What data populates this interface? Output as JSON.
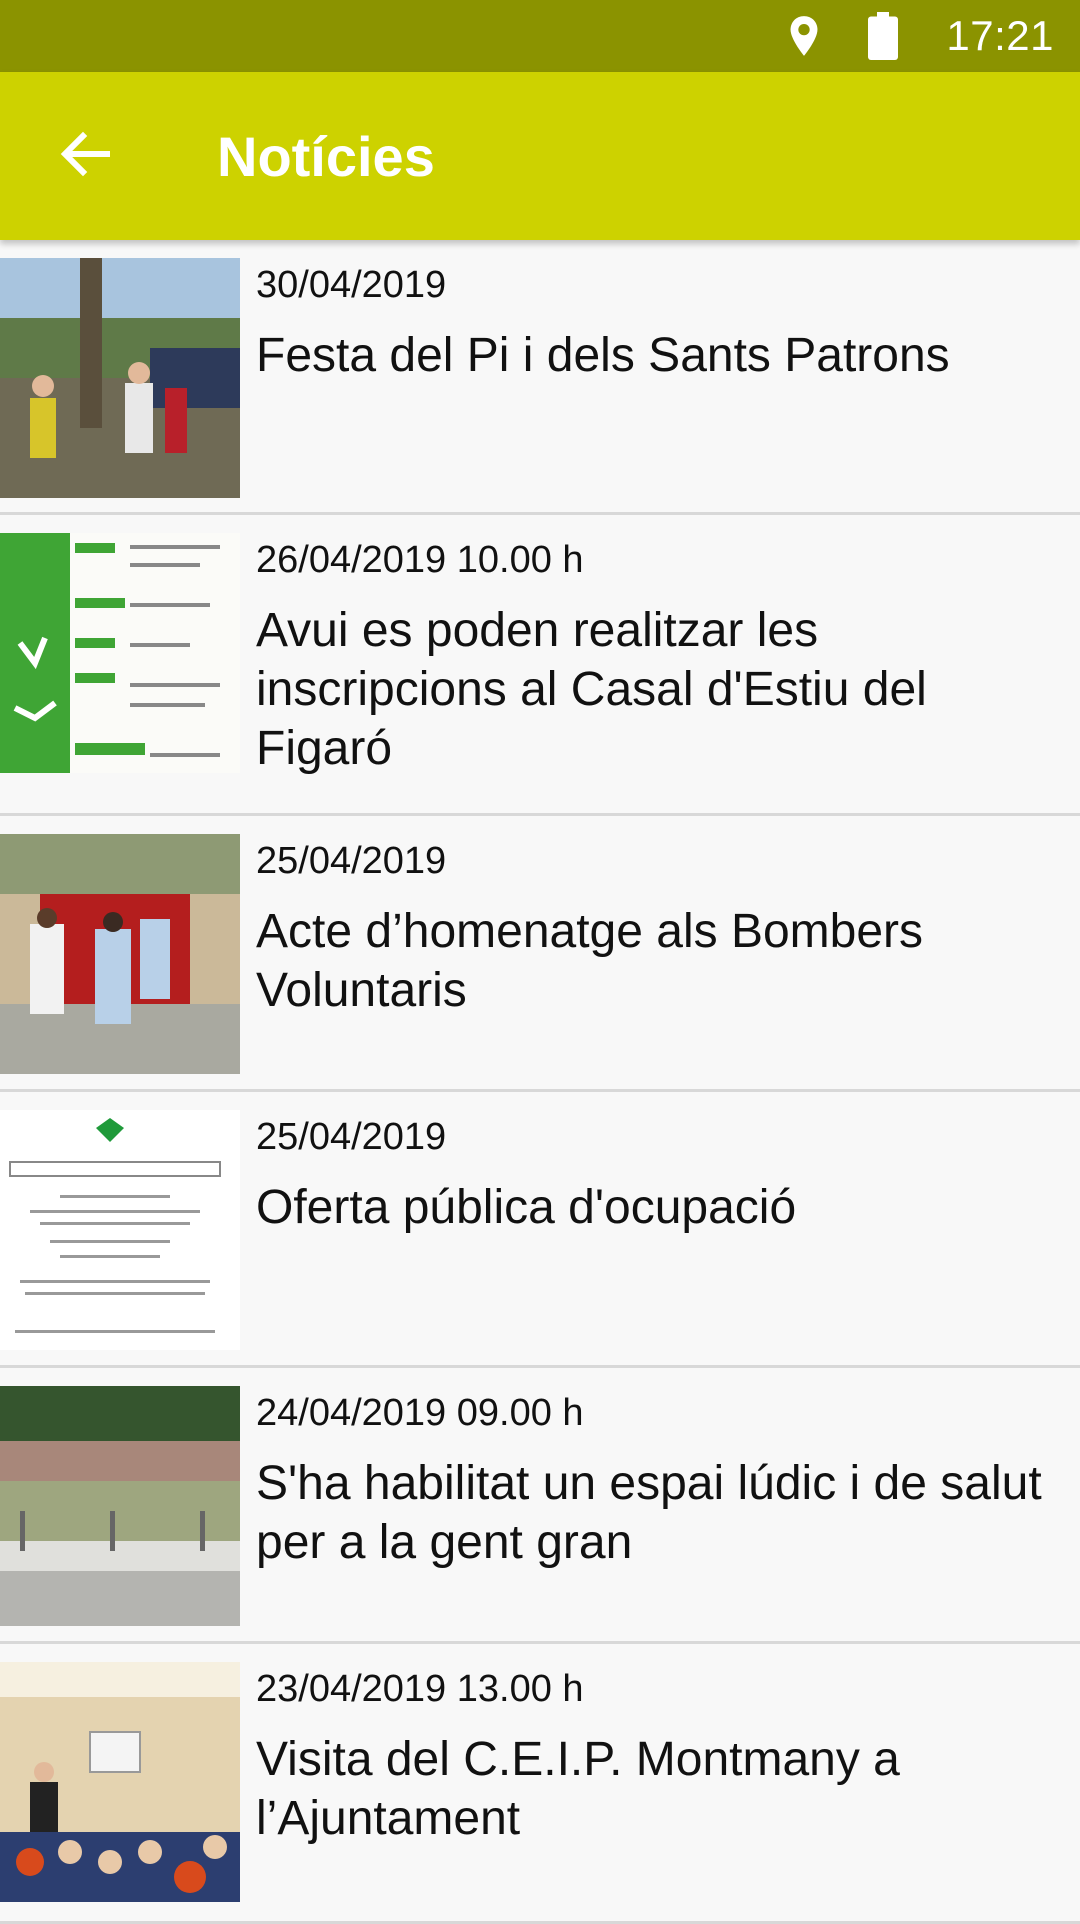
{
  "status": {
    "time": "17:21",
    "icons": [
      "location-icon",
      "battery-icon"
    ]
  },
  "appbar": {
    "title": "Notícies",
    "back_icon": "arrow-left-icon"
  },
  "news": [
    {
      "date": "30/04/2019",
      "title": "Festa del Pi i dels Sants Patrons"
    },
    {
      "date": "26/04/2019 10.00 h",
      "title": "Avui es poden realitzar les inscripcions al Casal d'Estiu del Figaró"
    },
    {
      "date": "25/04/2019",
      "title": "Acte d’homenatge als Bombers Voluntaris"
    },
    {
      "date": "25/04/2019",
      "title": "Oferta pública d'ocupació"
    },
    {
      "date": "24/04/2019 09.00 h",
      "title": "S'ha habilitat un espai lúdic i de salut per a la gent gran"
    },
    {
      "date": "23/04/2019 13.00 h",
      "title": "Visita del C.E.I.P. Montmany a l’Ajuntament"
    }
  ],
  "colors": {
    "status_bar": "#8b9300",
    "app_bar": "#cdd200",
    "background": "#f8f8f8",
    "divider": "#d8d8d8"
  }
}
